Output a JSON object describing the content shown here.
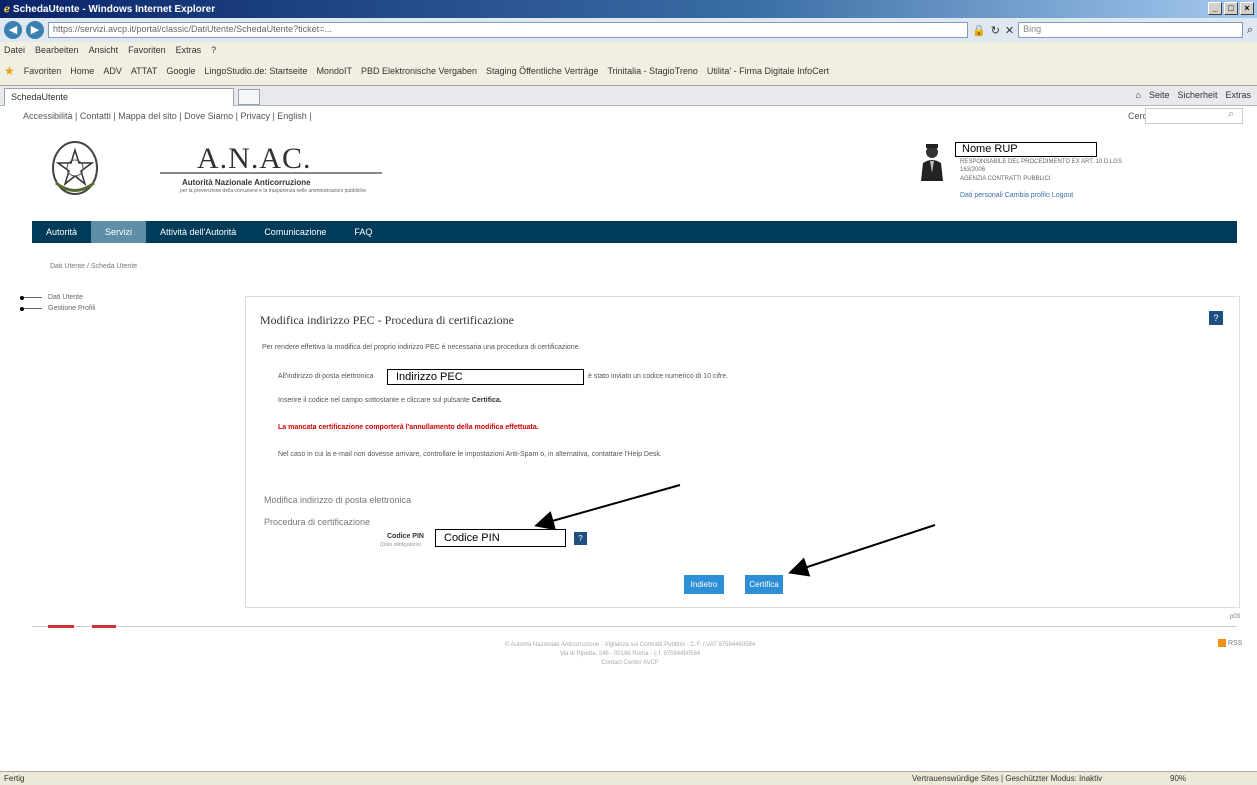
{
  "window": {
    "title": "SchedaUtente - Windows Internet Explorer",
    "address": "https://servizi.avcp.it/portal/classic/DatiUtente/SchedaUtente?ticket=...",
    "search_placeholder": "Bing",
    "tab_label": "SchedaUtente",
    "menu": [
      "Datei",
      "Bearbeiten",
      "Ansicht",
      "Favoriten",
      "Extras",
      "?"
    ],
    "favorites": [
      "Favoriten",
      "Home",
      "ADV",
      "ATTAT",
      "Google",
      "LingoStudio.de: Startseite",
      "MondoIT",
      "PBD Elektronische Vergaben",
      "Staging Öffentliche Verträge",
      "Trinitalia - StagioTreno",
      "Utilita' - Firma Digitale InfoCert"
    ],
    "command_bar": [
      "Seite",
      "Sicherheit",
      "Extras"
    ],
    "status_left": "Fertig",
    "status_zone": "Vertrauenswürdige Sites | Geschützter Modus: Inaktiv",
    "status_zoom": "90%"
  },
  "top_links": "Accessibilità | Contatti | Mappa del sito | Dove Siamo | Privacy | English |",
  "search_label": "Cerca",
  "header": {
    "title": "A.N.AC.",
    "subtitle": "Autorità Nazionale Anticorruzione",
    "small_text": "per la prevenzione della corruzione e la trasparenza nelle amministrazioni pubbliche"
  },
  "user": {
    "name": "Nome RUP",
    "role_line1": "RESPONSABILE DEL PROCEDIMENTO EX ART. 10 D.LGS",
    "role_line2": "163/2006",
    "org": "AGENZIA CONTRATTI PUBBLICI",
    "links": "Dati personali   Cambia profilo   Logout"
  },
  "nav": {
    "items": [
      "Autorità",
      "Servizi",
      "Attività dell'Autorità",
      "Comunicazione",
      "FAQ"
    ]
  },
  "breadcrumb": "Dati Utente / Scheda Utente",
  "tree": [
    "Dati Utente",
    "Gestione Profili"
  ],
  "panel": {
    "title": "Modifica indirizzo PEC - Procedura di certificazione",
    "intro": "Per rendere effettiva la modifica del proprio indirizzo PEC è necessaria una procedura di certificazione.",
    "p1_before": "All'indirizzo di posta elettronica",
    "pec_value": "Indirizzo PEC",
    "p1_after": "è stato inviato un codice numerico di 10 cifre.",
    "p2": "Inserire il codice nel campo sottostante e cliccare sul pulsante",
    "p2_bold": "Certifica.",
    "warning": "La mancata certificazione comporterà l'annullamento della modifica effettuata.",
    "p3": "Nel caso in cui la e-mail non dovesse arrivare, controllare le impostazioni Anti-Spam o, in alternativa, contattare l'Help Desk.",
    "section1": "Modifica indirizzo di posta elettronica",
    "section2": "Procedura di certificazione",
    "pin_label": "Codice PIN",
    "pin_hint": "(Dato obbligatorio)",
    "pin_value": "Codice PIN",
    "btn_cancel": "Indietro",
    "btn_certify": "Certifica"
  },
  "footer": {
    "line1": "© Autorità Nazionale Anticorruzione - Vigilanza sui Contratti Pubblici - C.F. / VAT 97584460584",
    "line2": "Via di Ripetta, 246 - 00186 Roma - c.f. 97584460584",
    "line3": "Contact Center AVCP",
    "rss_num": "p03",
    "rss": "RSS"
  }
}
